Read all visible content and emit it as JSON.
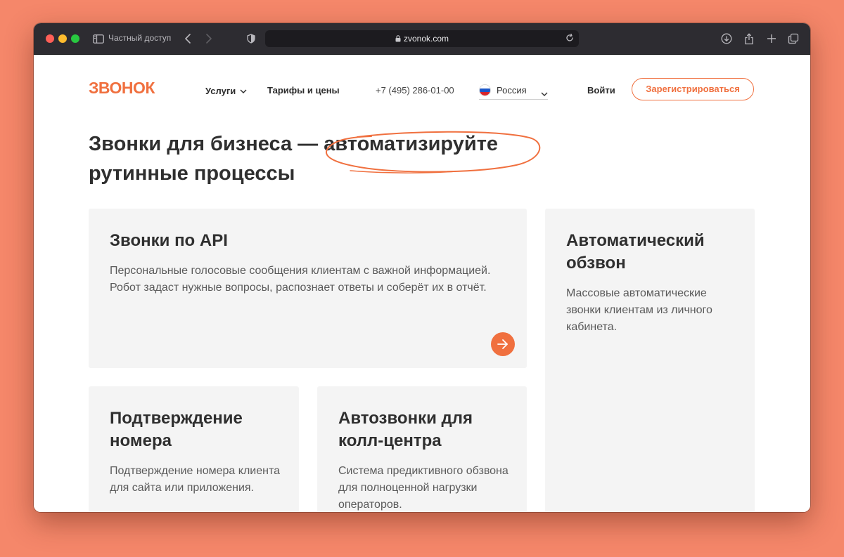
{
  "browser": {
    "private_label": "Частный доступ",
    "url": "zvonok.com"
  },
  "header": {
    "logo_text": "ЗВОНОК",
    "nav": {
      "services": "Услуги",
      "prices": "Тарифы и цены"
    },
    "phone": "+7 (495) 286-01-00",
    "country": "Россия",
    "login": "Войти",
    "register": "Зарегистрироваться"
  },
  "hero": {
    "title_start": "Звонки для бизнеса — ",
    "title_highlight": "автоматизируйте",
    "title_end": "рутинные процессы"
  },
  "cards": {
    "api": {
      "title": "Звонки по API",
      "desc": "Персональные голосовые сообщения клиентам с важной информацией. Робот задаст нужные вопросы, распознает ответы и соберёт их в отчёт."
    },
    "auto": {
      "title": "Автоматический обзвон",
      "desc": "Массовые автоматические звонки клиентам из личного кабинета."
    },
    "confirm": {
      "title": "Подтверждение номера",
      "desc": "Подтверждение номера клиента для сайта или приложения."
    },
    "callcenter": {
      "title": "Автозвонки для колл-центра",
      "desc": "Система предиктивного обзвона для полноценной нагрузки операторов."
    }
  },
  "colors": {
    "accent": "#F0703F",
    "background": "#F5876A",
    "card": "#F4F4F4",
    "titlebar": "#2D2C31"
  },
  "icons": [
    "sidebar-icon",
    "back-icon",
    "forward-icon",
    "shield-icon",
    "lock-icon",
    "reload-icon",
    "download-icon",
    "share-icon",
    "new-tab-icon",
    "tabs-icon",
    "chevron-down-icon",
    "arrow-right-icon"
  ]
}
